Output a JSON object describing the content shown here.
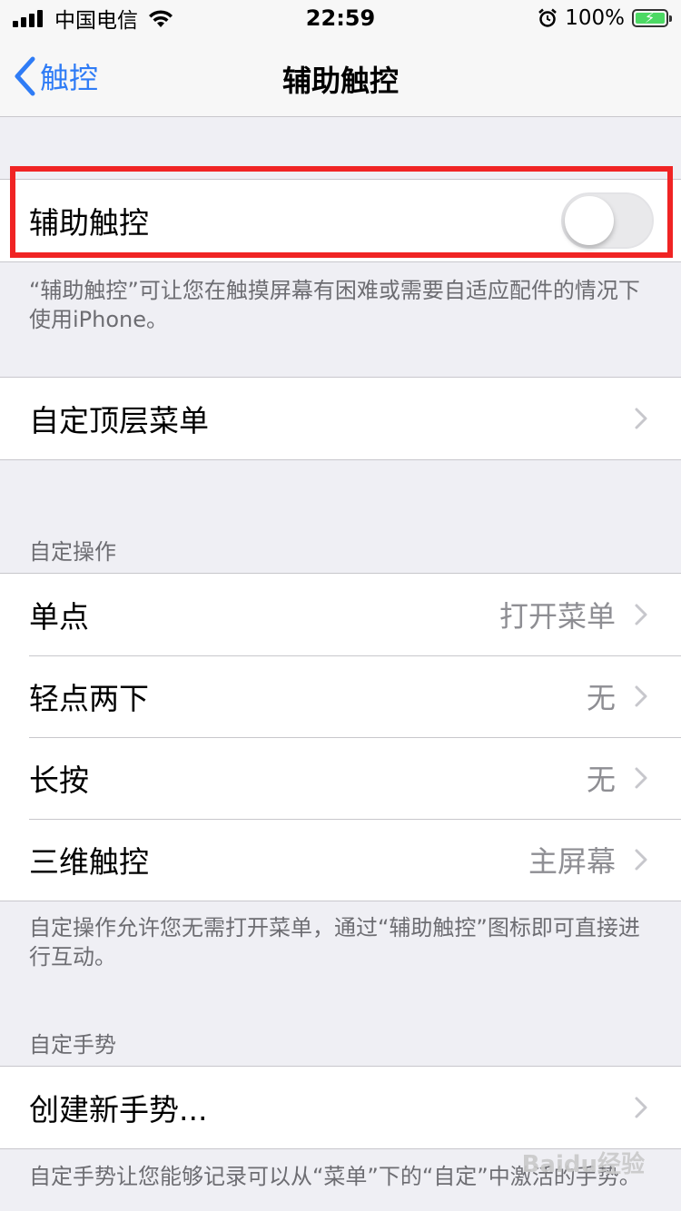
{
  "status_bar": {
    "carrier": "中国电信",
    "time": "22:59",
    "battery_percent": "100%"
  },
  "nav": {
    "back_label": "触控",
    "title": "辅助触控"
  },
  "assistive_touch": {
    "label": "辅助触控",
    "toggle_on": false,
    "footer": "“辅助触控”可让您在触摸屏幕有困难或需要自适应配件的情况下使用iPhone。"
  },
  "top_level_menu": {
    "label": "自定顶层菜单"
  },
  "custom_actions": {
    "header": "自定操作",
    "rows": [
      {
        "label": "单点",
        "value": "打开菜单"
      },
      {
        "label": "轻点两下",
        "value": "无"
      },
      {
        "label": "长按",
        "value": "无"
      },
      {
        "label": "三维触控",
        "value": "主屏幕"
      }
    ],
    "footer": "自定操作允许您无需打开菜单，通过“辅助触控”图标即可直接进行互动。"
  },
  "custom_gestures": {
    "header": "自定手势",
    "create_label": "创建新手势...",
    "footer": "自定手势让您能够记录可以从“菜单”下的“自定”中激活的手势。"
  },
  "watermark": "Baidu经验",
  "colors": {
    "accent": "#2f7cf6",
    "highlight": "#f02424",
    "background": "#efeff4"
  }
}
